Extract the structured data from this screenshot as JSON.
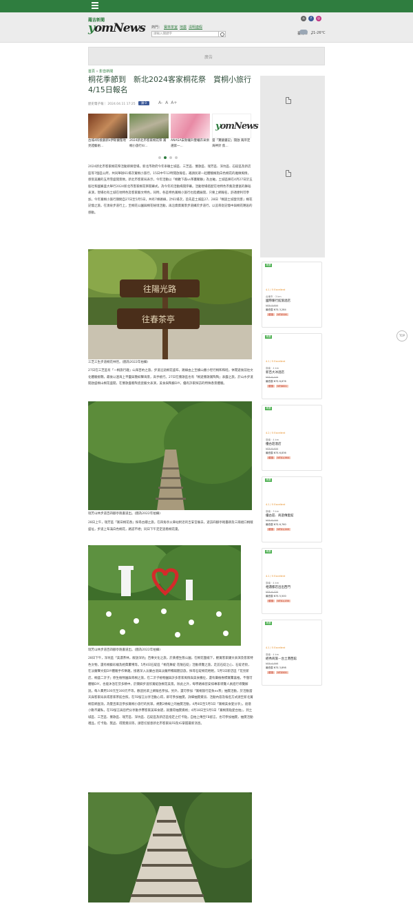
{
  "header": {
    "logo_sub": "羅吉新聞",
    "logo_main_prefix": "y",
    "logo_main_rest": "omNews",
    "hot_label": "熱門：",
    "hot_links": [
      "寶林茶室",
      "地震",
      "清明連假"
    ],
    "search_placeholder": "請輸入關鍵字",
    "city": "臺南市",
    "temperature": "21-26°C"
  },
  "ad_label": "廣告",
  "breadcrumb": {
    "home": "首頁",
    "sep": "»",
    "section": "影音新聞"
  },
  "article": {
    "title": "桐花季節到　新北2024客家桐花祭　賞桐小旅行4/15日報名",
    "author_time": "歷史電子報｜ 2024.04.11 17:25",
    "fb_label": "讚 0",
    "font_sizes": [
      "A-",
      "A",
      "A+"
    ],
    "para1": "2024新北市客家桐花祭活動即將登場，新北市政府今年串聯土城區、三芝區、鶯歌區、瑞芳區、深坑區、石碇區及新店區等7個區公所，共同舉辦61場次賞桐小旅行，15日中午12時開放報名，邀請民眾一起體驗擁抱白色桐花的雅緻風情，感受美麗的五月雪盛開景致。新北市客家局表示，今年活動以「桐歡下森vs茶畫聚聯」為主軸，土城區將在4月27日於五股社和國賓盛大舉行2024新北市客家桐花祭開幕式，為今年的活動揭開序幕。活動現場搭配在地特色市集及豐富的舞蹈表演，現場也有土城在地特色及客家藝文特色，同時，各區特色賞桐小旅行也陸續展開，只要上網報名，舒適便利可參加，今年賞桐小旅行期間自27日至5月5日，共有7條路線，計61場次，首先是土城區27、28日「桐遊土城愛玩客」桐花記憶之旅，在湧泉步道行上，至桐花公園與桐花秘境活動，再沿資資賞景步道攝於步道行，以追尋從記憶中與桐花邂逅的感動。",
    "photo1_caption": "三芝三生步道桐花林徑。(圖為2022年拍攝)",
    "para2": "27日在三芝區有「一桐旅行趣」山海百約之旅，步道沿途桐花盛布，路線由上至橫山腰小徑行桐和和睦，休閒遊後前往文化體驗挑戰，最後以連海上平靈與簡如聲海景，高手桃行。27日在鶯歌區也有「桐遊鶯歌賞陶陶」表露之旅，於山水步道開啟盛桐山桐花盛開，在鶯歌盡看陶瓷瓷藝文表演，美食與陶藝DIY，優有許家探訪的特殊香景體驗。",
    "photo2_caption": "瑞芳山林步道百四腳亭跑書道出。(圖為2022年拍攝)",
    "para3": "28日上午，瑞芳區「賞日桐花香」探尋古蹟之旅，在四角亭火車站附近的吉安宮廟去，遊訪四腳亭砲臺跡及三兩組口桐蔭盛址，步道上布滿白色桐花，路認不絕；同日下午定定遊看桐花棗。",
    "photo3_caption": "瑞芳山林步道百四腳亭跑書道出。(圖為2022年拍攝)",
    "para4": "28日下午，深坑區「美濃茶林，飯放深坑」百樂文化之旅，於黃禮生態公園，在桐花圍繞下，觀賞客家鑼文表演及客家特色文物，還有桐藝彩繪及經典驚嘆等。5月4日石碇區「桐花舞綻 花隨石碇」活動導覽之旅，走訪石碇之心、石碇老街，在淡蘭聲文館DIY體驗手作樂趣，接著深入淡蘭古道與淡蘭所暢蹊聽訪旅，探尋石碇桐花輕輕。5月5日新店區「花見新店，桐盛二沂子」原生植物園與尋桐之旅，在二沂子植物園與許多客家風情與美食攤位，還有藥植樹標賞驚喜推，不僅可體驗DIY，也能沐浴在芬多精中，於關僻步道欣賞綻放桐花美景。除此之外，每學路線皆安排專家導覽人員進行導覽解說，每人費用100元至300元不等，歡迎民眾上網報名參加。另外，還可參加「賞桐旅行是負ex茶」抽獎活動，於活動當天與客家局表或客家茶館合照，在FB留言分享活動心得，即可參加抽獎，詳細抽獎資訊、活動內容及報名方式請至新北賞桐官網查詢，為雙且來這參加賞桐小旅行的民眾，規劃2條線上的抽獎活動，4月8日至5月5日「賞桐美食愛分享」，創意小勳不藏私，在FB留言與您們分享動手賽客家美味食譜，就獲得抽獎資格；4月18日至5月5日「賞桐景點愛台拍」，到土城區、三芝區、鶯歌區、瑞芳區、深坑區、石碇區及新店區指定之打卡點，自拍上傳至FB留言，也可參加抽獎，抽獎活動禮品，打卡點、獎品、得獎資訊等，請密切留意新北市客家局FB及IG掌握最新消息。"
  },
  "related": [
    {
      "caption": "古城4料接劇新k伊斯蘭聖地 見證藝術..."
    },
    {
      "caption": "2024新北市客家桐花祭 賞桐小旅行4/..."
    },
    {
      "caption": "ANASA安耐曬升雙曬衣采俱選第一..."
    },
    {
      "caption": "當「寶鏡書記」開啟 兩岸定海神針 焦..."
    }
  ],
  "hotels": [
    {
      "tag": "精選",
      "rating": "4.1 / 5 Excellent",
      "dist": "台東市 · 3 km",
      "name": "國際暖行館旅酒店",
      "orig": "NT$ 3,800",
      "price": "最低價 NT$ 3,284",
      "deal_label": "優惠",
      "deal": "NT$516"
    },
    {
      "tag": "精選",
      "rating": "4.1 / 5 Excellent",
      "dist": "臺南 · 4 km",
      "name": "新百大冰酒店",
      "orig": "NT$ 8,270",
      "price": "最低價 NT$ 6,876",
      "deal_label": "優惠",
      "deal": "NT$821"
    },
    {
      "tag": "精選",
      "rating": "4.2 / 5 Excellent",
      "dist": "臺南 · 4 km",
      "name": "優古莊酒店",
      "orig": "NT$ 8,400",
      "price": "最低價 NT$ 6,836",
      "deal_label": "優惠",
      "deal": "NT$1,564"
    },
    {
      "tag": "精選",
      "rating": "4.1 / 5 Excellent",
      "dist": "臺南 · 3 km",
      "name": "優古莊．商遊傳愛館",
      "orig": "NT$ 8,000",
      "price": "最低價 NT$ 6,760",
      "deal_label": "優惠",
      "deal": "NT$1,240"
    },
    {
      "tag": "精選",
      "rating": "4.1 / 5 Excellent",
      "dist": "臺南 · 4 km",
      "name": "相遇都店出出西門",
      "orig": "NT$ 6,730",
      "price": "最低價 NT$ 5,500",
      "deal_label": "優惠",
      "deal": "NT$1,230"
    },
    {
      "tag": "精選",
      "rating": "4.1 / 5 Excellent",
      "dist": "臺南 · 4 km",
      "name": "經秀商旅－台土港西館",
      "orig": "NT$ 4,398",
      "price": "最低價 NT$ 3,898",
      "deal_label": "優惠",
      "deal": "NT$500"
    }
  ],
  "go_top": "TOP"
}
